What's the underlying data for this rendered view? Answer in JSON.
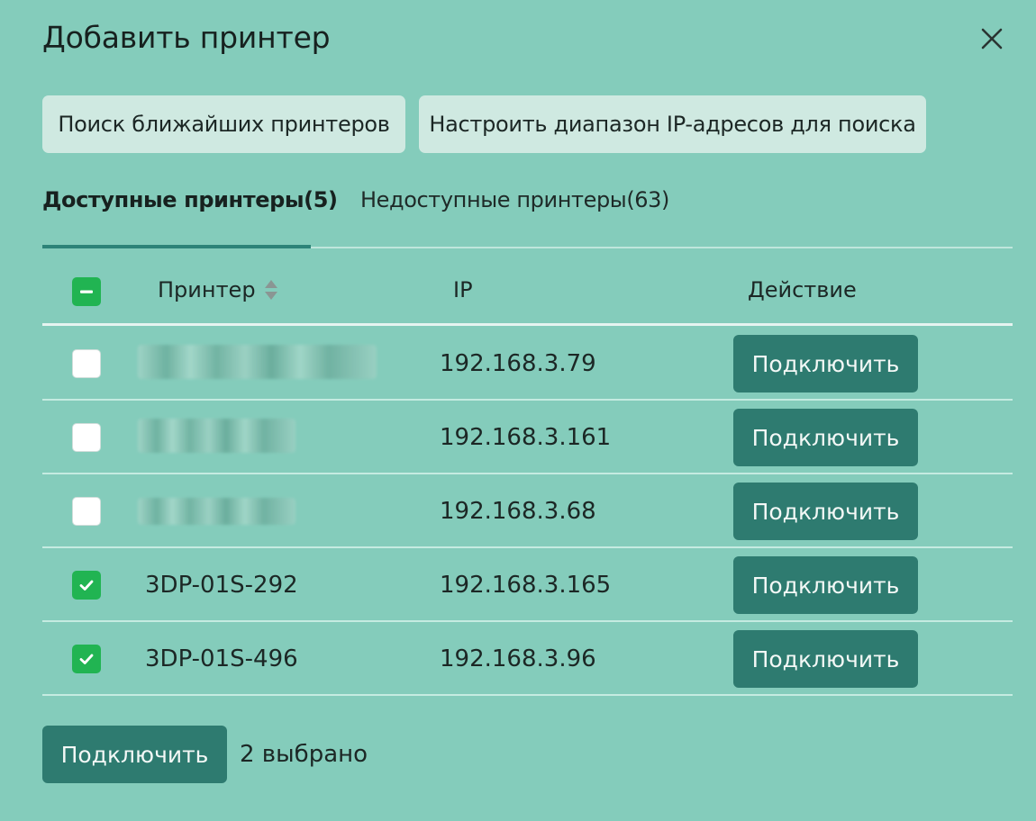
{
  "dialog": {
    "title": "Добавить принтер",
    "close_icon": "close-icon"
  },
  "actions": {
    "search_nearby": "Поиск ближайших принтеров",
    "configure_range": "Настроить диапазон IP-адресов для поиска"
  },
  "tabs": [
    {
      "label": "Доступные принтеры(5)",
      "active": true
    },
    {
      "label": "Недоступные принтеры(63)",
      "active": false
    }
  ],
  "table": {
    "headers": {
      "printer": "Принтер",
      "ip": "IP",
      "action": "Действие"
    },
    "sort_icon": "sort-icon",
    "select_all_state": "indeterminate",
    "rows": [
      {
        "name": "",
        "name_obscured": true,
        "ip": "192.168.3.79",
        "checked": false,
        "action": "Подключить"
      },
      {
        "name": "",
        "name_obscured": true,
        "ip": "192.168.3.161",
        "checked": false,
        "action": "Подключить"
      },
      {
        "name": "",
        "name_obscured": true,
        "ip": "192.168.3.68",
        "checked": false,
        "action": "Подключить"
      },
      {
        "name": "3DP-01S-292",
        "name_obscured": false,
        "ip": "192.168.3.165",
        "checked": true,
        "action": "Подключить"
      },
      {
        "name": "3DP-01S-496",
        "name_obscured": false,
        "ip": "192.168.3.96",
        "checked": true,
        "action": "Подключить"
      }
    ]
  },
  "footer": {
    "connect_label": "Подключить",
    "selected_text": "2 выбрано"
  },
  "colors": {
    "background": "#84ccbb",
    "primary_button": "#2e7b70",
    "checkbox_checked": "#21b452",
    "tab_underline": "#2d8378"
  }
}
